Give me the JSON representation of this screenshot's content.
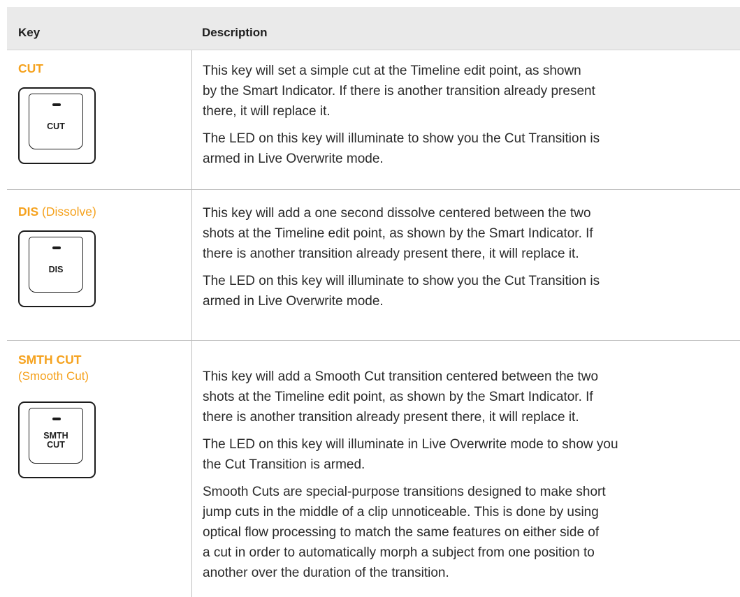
{
  "header": {
    "key_label": "Key",
    "description_label": "Description"
  },
  "rows": [
    {
      "key_name": "CUT",
      "key_suffix": "",
      "key_sub": "",
      "keycap_lines": [
        "CUT"
      ],
      "paragraphs": [
        [
          "This key will set a simple cut at the Timeline edit point, as shown",
          "by the Smart Indicator. If there is another transition already present",
          "there, it will replace it."
        ],
        [
          "The LED on this key will illuminate to show you the Cut Transition is",
          "armed in Live Overwrite mode."
        ]
      ]
    },
    {
      "key_name": "DIS",
      "key_suffix": " (Dissolve)",
      "key_sub": "",
      "keycap_lines": [
        "DIS"
      ],
      "paragraphs": [
        [
          "This key will add a one second dissolve centered between the two",
          "shots at the Timeline edit point, as shown by the Smart Indicator. If",
          "there is another transition already present there, it will replace it."
        ],
        [
          "The LED on this key will illuminate to show you the Cut Transition is",
          "armed in Live Overwrite mode."
        ]
      ]
    },
    {
      "key_name": "SMTH CUT",
      "key_suffix": "",
      "key_sub": "(Smooth Cut)",
      "keycap_lines": [
        "SMTH",
        "CUT"
      ],
      "paragraphs": [
        [
          "This key will add a Smooth Cut transition centered between the two",
          "shots at the Timeline edit point, as shown by the Smart Indicator. If",
          "there is another transition already present there, it will replace it."
        ],
        [
          "The LED on this key will illuminate in Live Overwrite mode to show you",
          "the Cut Transition is armed."
        ],
        [
          "Smooth Cuts are special-purpose transitions designed to make short",
          "jump cuts in the middle of a clip unnoticeable. This is done by using",
          "optical flow processing to match the same features on either side of",
          "a cut in order to automatically morph a subject from one position to",
          "another over the duration of the transition."
        ]
      ]
    }
  ],
  "colors": {
    "accent": "#f5a21e",
    "header_bg": "#eaeaea",
    "rule": "#bdbdbd",
    "text": "#2a2a2a"
  }
}
